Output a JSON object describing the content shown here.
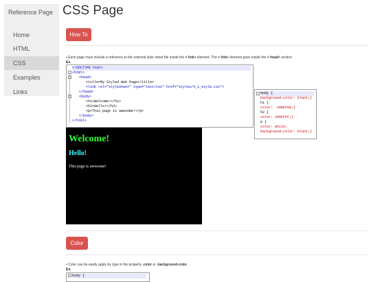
{
  "sidebar": {
    "title": "Reference Page",
    "items": [
      {
        "label": "Home"
      },
      {
        "label": "HTML"
      },
      {
        "label": "CSS",
        "active": true
      },
      {
        "label": "Examples"
      },
      {
        "label": "Links"
      }
    ]
  },
  "page_title": "CSS Page",
  "sections": [
    {
      "button": "How To",
      "desc_parts": [
        "• Each page must include a reference to the external style sheet file inside the ",
        "< link>",
        " element. The ",
        "< link>",
        " element goes inside the ",
        "< head>",
        " section."
      ],
      "ex_label": "Ex.",
      "html_code": [
        "<!DOCTYPE html>",
        "<html>",
        "<head>",
        "<title>My Styled Web Page</title>",
        "<link rel=\"stylesheet\" type=\"text/css\" href=\"styles/4_1_style.css\">",
        "</head>",
        "<body>",
        "<h1>Welcome!</h1>",
        "<h2>Hello!</h2>",
        "<p>This page is awesome!</p>",
        "</body>",
        "</html>"
      ],
      "css_code": [
        "body {",
        "background-color: black;}",
        "h1 {",
        "color:  #00FF00;}",
        "h2 {",
        "color: #00FFFF;}",
        "p {",
        "color: white;",
        "background-color: black;}"
      ],
      "preview": {
        "h1": "Welcome!",
        "h2": "Hello!",
        "p": "This page is awesome!"
      }
    },
    {
      "button": "Color",
      "desc_parts": [
        "• Color can be easily apply by type in the property ",
        ".color",
        " or ",
        ".background-color",
        "."
      ],
      "ex_label": "Ex.",
      "css_code": [
        "body {"
      ]
    }
  ]
}
